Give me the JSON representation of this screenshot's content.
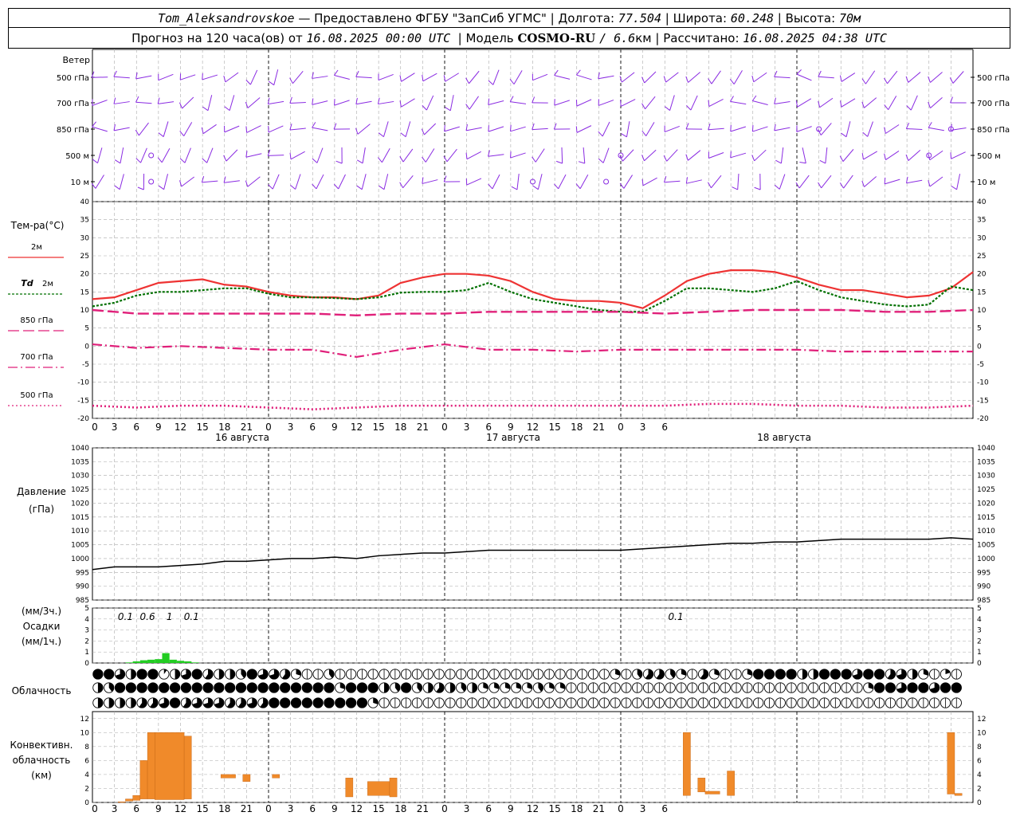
{
  "header": {
    "station": "Tom_Aleksandrovskoe",
    "provider": "— Предоставлено ФГБУ \"ЗапСиб УГМС\"",
    "lon_label": "Долгота:",
    "lon_value": "77.504",
    "lat_label": "Широта:",
    "lat_value": "60.248",
    "alt_label": "Высота:",
    "alt_value": "70м",
    "fc_label": "Прогноз на 120 часа(ов) от",
    "fc_start": "16.08.2025 00:00 UTC",
    "model_label": "Модель",
    "model_name": "COSMO-RU",
    "model_res": "/ 6.6",
    "model_res_unit": "км",
    "calc_label": "Рассчитано:",
    "calc_time": "16.08.2025 04:38 UTC"
  },
  "labels": {
    "wind": "Ветер",
    "temp": "Тем-ра(°C)",
    "pressure_1": "Давление",
    "pressure_2": "(гПа)",
    "precip_1": "(мм/3ч.)",
    "precip_2": "Осадки",
    "precip_3": "(мм/1ч.)",
    "cloud": "Облачность",
    "conv_1": "Конвективн.",
    "conv_2": "облачность",
    "conv_3": "(км)"
  },
  "colors": {
    "wind": "#8a2be2",
    "t2m": "#ee3333",
    "td2m": "#007000",
    "t850": "#e0207a",
    "t700": "#e0207a",
    "t500": "#e0207a",
    "pressure": "#000000",
    "precip": "#22cc22",
    "conv": "#f08a2a",
    "grid": "#aaaaaa"
  },
  "chart_data": [
    {
      "type": "wind_barbs",
      "levels": [
        "500 гПа",
        "700 гПа",
        "850 гПа",
        "500 м",
        "10 м"
      ],
      "x_hours": [
        0,
        120
      ],
      "calm_markers": [
        {
          "level": "500 м",
          "hour": 8
        },
        {
          "level": "10 м",
          "hour": 8
        },
        {
          "level": "10 м",
          "hour": 60
        },
        {
          "level": "10 м",
          "hour": 70
        },
        {
          "level": "500 м",
          "hour": 72
        },
        {
          "level": "850 гПа",
          "hour": 99
        },
        {
          "level": "500 м",
          "hour": 114
        },
        {
          "level": "850 гПа",
          "hour": 117
        }
      ]
    },
    {
      "type": "line",
      "ylim": [
        -20,
        40
      ],
      "yticks": [
        -20,
        -15,
        -10,
        -5,
        0,
        5,
        10,
        15,
        20,
        25,
        30,
        35,
        40
      ],
      "x_ticks": [
        "0",
        "3",
        "6",
        "9",
        "12",
        "15",
        "18",
        "21",
        "0",
        "3",
        "6",
        "9",
        "12",
        "15",
        "18",
        "21",
        "0",
        "3",
        "6",
        "9",
        "12",
        "15",
        "18",
        "21",
        "0",
        "3",
        "6"
      ],
      "date_labels": [
        "16 августа",
        "17 августа",
        "18 августа"
      ],
      "series": [
        {
          "name": "2м",
          "style": "solid",
          "x": [
            0,
            3,
            6,
            9,
            12,
            15,
            18,
            21,
            24,
            27,
            30,
            33,
            36,
            39,
            42,
            45,
            48,
            51,
            54,
            57,
            60,
            63,
            66,
            69,
            72,
            75,
            78,
            81,
            84,
            87,
            90,
            93,
            96,
            99,
            102,
            105,
            108,
            111,
            114,
            117,
            120
          ],
          "y": [
            13,
            13.5,
            15.5,
            17.5,
            18,
            18.5,
            17,
            16.5,
            15,
            14,
            13.5,
            13.5,
            13,
            14,
            17.5,
            19,
            20,
            20,
            19.5,
            18,
            15,
            13,
            12.5,
            12.5,
            12,
            10.5,
            14,
            18,
            20,
            21,
            21,
            20.5,
            19,
            17,
            15.5,
            15.5,
            14.5,
            13.5,
            14,
            16,
            20.5
          ]
        },
        {
          "name": "Td 2м",
          "style": "dotted",
          "x": [
            0,
            3,
            6,
            9,
            12,
            15,
            18,
            21,
            24,
            27,
            30,
            33,
            36,
            39,
            42,
            45,
            48,
            51,
            54,
            57,
            60,
            63,
            66,
            69,
            72,
            75,
            78,
            81,
            84,
            87,
            90,
            93,
            96,
            99,
            102,
            105,
            108,
            111,
            114,
            117,
            120
          ],
          "y": [
            11,
            12,
            14,
            15,
            15,
            15.5,
            16,
            16,
            14.5,
            13.5,
            13.5,
            13.3,
            13,
            13.5,
            14.8,
            15,
            15,
            15.5,
            17.5,
            15,
            13,
            12,
            11,
            10,
            9.5,
            9.5,
            12.5,
            16,
            16,
            15.5,
            15,
            16,
            18,
            15.5,
            13.5,
            12.5,
            11.5,
            11,
            11.5,
            16.5,
            15.5
          ]
        },
        {
          "name": "850 гПа",
          "style": "dash",
          "x": [
            0,
            6,
            12,
            18,
            24,
            30,
            36,
            42,
            48,
            54,
            60,
            66,
            72,
            78,
            84,
            90,
            96,
            102,
            108,
            114,
            120
          ],
          "y": [
            10,
            9,
            9,
            9,
            9,
            9,
            8.5,
            9,
            9,
            9.5,
            9.5,
            9.5,
            9.5,
            9,
            9.5,
            10,
            10,
            10,
            9.5,
            9.5,
            10
          ]
        },
        {
          "name": "700 гПа",
          "style": "dashdot",
          "x": [
            0,
            6,
            12,
            18,
            24,
            30,
            36,
            42,
            48,
            54,
            60,
            66,
            72,
            78,
            84,
            90,
            96,
            102,
            108,
            114,
            120
          ],
          "y": [
            0.5,
            -0.5,
            0,
            -0.5,
            -1,
            -1,
            -3,
            -1,
            0.5,
            -1,
            -1,
            -1.5,
            -1,
            -1,
            -1,
            -1,
            -1,
            -1.5,
            -1.5,
            -1.5,
            -1.5
          ]
        },
        {
          "name": "500 гПа",
          "style": "dots",
          "x": [
            0,
            6,
            12,
            18,
            24,
            30,
            36,
            42,
            48,
            54,
            60,
            66,
            72,
            78,
            84,
            90,
            96,
            102,
            108,
            114,
            120
          ],
          "y": [
            -16.5,
            -17,
            -16.5,
            -16.5,
            -17,
            -17.5,
            -17,
            -16.5,
            -16.5,
            -16.5,
            -16.5,
            -16.5,
            -16.5,
            -16.5,
            -16,
            -16,
            -16.5,
            -16.5,
            -17,
            -17,
            -16.5
          ]
        }
      ]
    },
    {
      "type": "line",
      "ylim": [
        985,
        1040
      ],
      "yticks": [
        985,
        990,
        995,
        1000,
        1005,
        1010,
        1015,
        1020,
        1025,
        1030,
        1035,
        1040
      ],
      "series": [
        {
          "name": "Давление",
          "x": [
            0,
            3,
            6,
            9,
            12,
            15,
            18,
            21,
            24,
            27,
            30,
            33,
            36,
            39,
            42,
            45,
            48,
            51,
            54,
            57,
            60,
            63,
            66,
            69,
            72,
            75,
            78,
            81,
            84,
            87,
            90,
            93,
            96,
            99,
            102,
            105,
            108,
            111,
            114,
            117,
            120
          ],
          "y": [
            996,
            997,
            997,
            997,
            997.5,
            998,
            999,
            999,
            999.5,
            1000,
            1000,
            1000.5,
            1000,
            1001,
            1001.5,
            1002,
            1002,
            1002.5,
            1003,
            1003,
            1003,
            1003,
            1003,
            1003,
            1003,
            1003.5,
            1004,
            1004.5,
            1005,
            1005.5,
            1005.5,
            1006,
            1006,
            1006.5,
            1007,
            1007,
            1007,
            1007,
            1007,
            1007.5,
            1007
          ]
        }
      ]
    },
    {
      "type": "bar",
      "ylim": [
        0,
        5
      ],
      "yticks": [
        0,
        1,
        2,
        3,
        4,
        5
      ],
      "x": [
        5,
        6,
        7,
        8,
        9,
        10,
        11,
        12,
        13,
        14
      ],
      "values": [
        0.05,
        0.15,
        0.25,
        0.3,
        0.35,
        0.9,
        0.3,
        0.2,
        0.15,
        0.05
      ],
      "labels_3h": [
        {
          "hour": 4.5,
          "text": "0.1"
        },
        {
          "hour": 7.5,
          "text": "0.6"
        },
        {
          "hour": 10.5,
          "text": "1"
        },
        {
          "hour": 13.5,
          "text": "0.1"
        },
        {
          "hour": 79.5,
          "text": "0.1"
        }
      ]
    },
    {
      "type": "table",
      "rows": 3,
      "columns": 40,
      "symbol_fractions": [
        [
          0.8,
          0.8,
          0.7,
          0.5,
          0.8,
          0.8,
          0.1,
          0.5,
          0.7,
          0.8,
          0.6,
          0.5,
          0.5,
          0.4,
          0.8,
          0.7,
          0.7,
          0.6,
          0.3,
          0,
          0,
          0.4,
          0,
          0,
          0,
          0,
          0,
          0,
          0,
          0,
          0,
          0,
          0,
          0,
          0,
          0,
          0,
          0,
          0,
          0,
          0,
          0,
          0,
          0,
          0,
          0,
          0,
          0.3,
          0,
          0.4,
          0.6,
          0.6,
          0.4,
          0.3,
          0,
          0.6,
          0.3,
          0,
          0,
          0.3,
          0.8,
          0.8,
          0.8,
          0.8,
          0.5,
          0.5,
          0.8,
          0.8,
          0.8,
          0.7,
          0.8,
          0.8,
          0.6,
          0.7,
          0.5,
          0.3,
          0,
          0.2,
          0,
          0,
          0
        ],
        [
          0.5,
          0.4,
          0.8,
          0.8,
          0.8,
          0.8,
          0.8,
          0.8,
          0.8,
          0.8,
          0.8,
          0.8,
          0.8,
          0.8,
          0.8,
          0.8,
          0.8,
          0.8,
          0.8,
          0.8,
          0.8,
          0.8,
          0.3,
          0.8,
          0.8,
          0.8,
          0.5,
          0.4,
          0.8,
          0.4,
          0.5,
          0.6,
          0.5,
          0.4,
          0.5,
          0.3,
          0.3,
          0.3,
          0.3,
          0.3,
          0.4,
          0.3,
          0.3,
          0,
          0,
          0,
          0,
          0,
          0,
          0,
          0,
          0,
          0,
          0,
          0,
          0,
          0,
          0,
          0,
          0,
          0,
          0,
          0,
          0,
          0,
          0,
          0,
          0,
          0,
          0,
          0.3,
          0.8,
          0.8,
          0.7,
          0.8,
          0.8,
          0.7,
          0.8,
          0.8,
          0,
          0.5
        ],
        [
          0.5,
          0.5,
          0.5,
          0.5,
          0.6,
          0.6,
          0.7,
          0.8,
          0.6,
          0.7,
          0.7,
          0.7,
          0.6,
          0.6,
          0.7,
          0.6,
          0.8,
          0.8,
          0.8,
          0.8,
          0.8,
          0.8,
          0.8,
          0.8,
          0.8,
          0.3,
          0,
          0,
          0,
          0,
          0,
          0,
          0,
          0,
          0,
          0,
          0,
          0,
          0,
          0,
          0,
          0,
          0,
          0,
          0,
          0,
          0,
          0,
          0,
          0,
          0,
          0,
          0,
          0,
          0,
          0,
          0,
          0,
          0,
          0,
          0,
          0,
          0,
          0,
          0,
          0,
          0,
          0,
          0,
          0,
          0,
          0,
          0,
          0,
          0,
          0,
          0,
          0,
          0,
          0,
          0
        ]
      ]
    },
    {
      "type": "bar",
      "ylim": [
        0,
        13
      ],
      "yticks": [
        0,
        2,
        4,
        6,
        8,
        10,
        12
      ],
      "bars": [
        {
          "x0": 3.5,
          "x1": 4.5,
          "bottom": 0,
          "top": 0.1
        },
        {
          "x0": 4.5,
          "x1": 5.5,
          "bottom": 0.2,
          "top": 0.5
        },
        {
          "x0": 5.5,
          "x1": 6.5,
          "bottom": 0.3,
          "top": 1
        },
        {
          "x0": 6.5,
          "x1": 7.5,
          "bottom": 0.5,
          "top": 6
        },
        {
          "x0": 7.5,
          "x1": 8.5,
          "bottom": 0.5,
          "top": 10
        },
        {
          "x0": 8.5,
          "x1": 12.5,
          "bottom": 0.4,
          "top": 10
        },
        {
          "x0": 12.5,
          "x1": 13.5,
          "bottom": 0.5,
          "top": 9.5
        },
        {
          "x0": 17.5,
          "x1": 19.5,
          "bottom": 3.5,
          "top": 4
        },
        {
          "x0": 20.5,
          "x1": 21.5,
          "bottom": 3,
          "top": 4
        },
        {
          "x0": 24.5,
          "x1": 25.5,
          "bottom": 3.5,
          "top": 4
        },
        {
          "x0": 34.5,
          "x1": 35.5,
          "bottom": 0.8,
          "top": 3.5
        },
        {
          "x0": 37.5,
          "x1": 40.5,
          "bottom": 1,
          "top": 3
        },
        {
          "x0": 40.5,
          "x1": 41.5,
          "bottom": 0.8,
          "top": 3.5
        },
        {
          "x0": 80.5,
          "x1": 81.5,
          "bottom": 1,
          "top": 10
        },
        {
          "x0": 82.5,
          "x1": 83.5,
          "bottom": 1.5,
          "top": 3.5
        },
        {
          "x0": 83.5,
          "x1": 85.5,
          "bottom": 1.2,
          "top": 1.6
        },
        {
          "x0": 86.5,
          "x1": 87.5,
          "bottom": 1,
          "top": 4.5
        },
        {
          "x0": 116.5,
          "x1": 117.5,
          "bottom": 1.2,
          "top": 10
        },
        {
          "x0": 117.5,
          "x1": 118.5,
          "bottom": 1,
          "top": 1.3
        }
      ]
    }
  ]
}
